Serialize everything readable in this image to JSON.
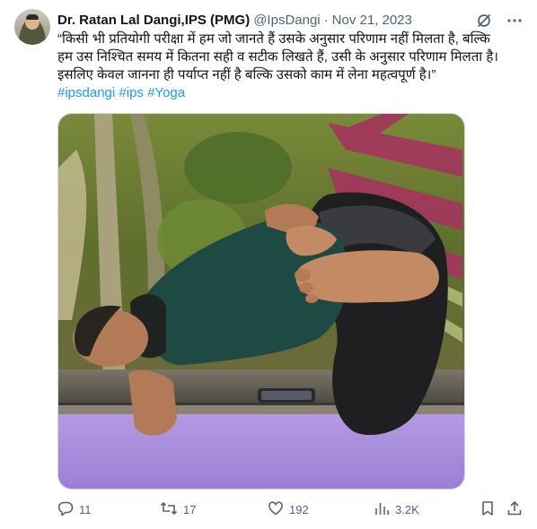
{
  "tweet": {
    "author_name": "Dr. Ratan Lal Dangi,IPS (PMG)",
    "handle": "@IpsDangi",
    "separator": "·",
    "date": "Nov 21, 2023",
    "text_lines": [
      "“किसी भी प्रतियोगी परीक्षा में हम जो जानते हैं उसके अनुसार परिणाम नहीं मिलता है, बल्कि",
      "हम उस निश्चित समय में कितना सही व सटीक लिखते हैं, उसी के अनुसार परिणाम मिलता है।",
      "इसलिए केवल जानना ही पर्याप्त नहीं है बल्कि उसको काम में लेना महत्वपूर्ण है।”"
    ],
    "hashtags": [
      "#ipsdangi",
      "#ips",
      "#Yoga"
    ]
  },
  "actions": {
    "replies": "11",
    "retweets": "17",
    "likes": "192",
    "views": "3.2K"
  },
  "icons": {
    "header": [
      "grok-icon",
      "more-icon"
    ],
    "actions": [
      "reply-icon",
      "retweet-icon",
      "like-icon",
      "views-icon",
      "bookmark-icon",
      "share-icon"
    ]
  },
  "colors": {
    "text": "#0f1419",
    "secondary": "#536471",
    "link": "#1d9bf0",
    "mat": "#a98bdc"
  }
}
